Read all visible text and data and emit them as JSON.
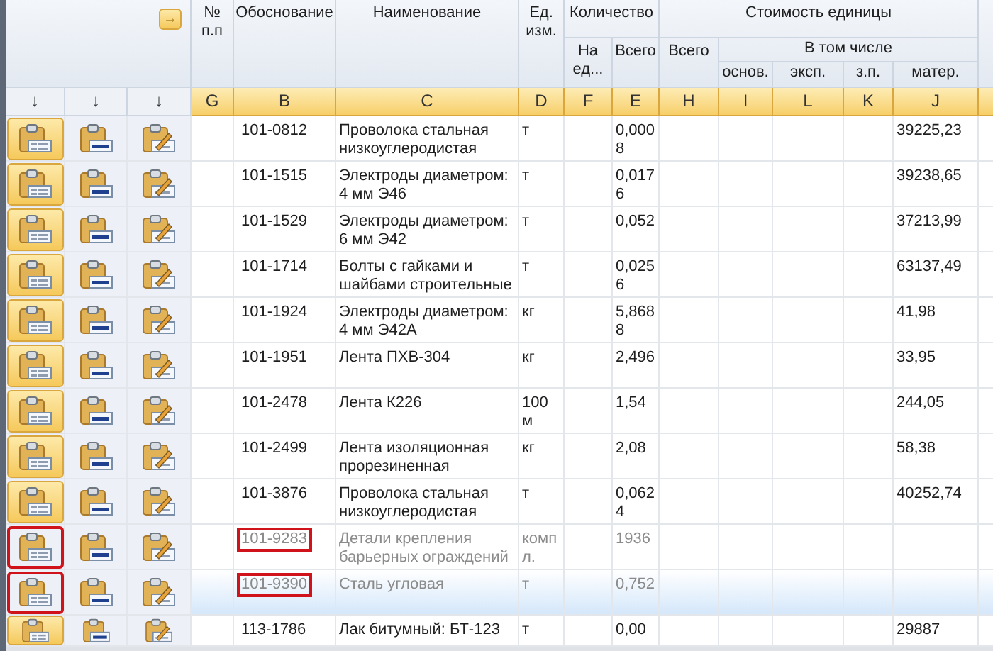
{
  "header": {
    "nav_button": "→",
    "icon_columns": [
      {
        "arrow": "↓"
      },
      {
        "arrow": "↓"
      },
      {
        "arrow": "↓"
      }
    ],
    "columns": [
      {
        "label": "№ п.п",
        "letter": "G"
      },
      {
        "label": "Обоснование",
        "letter": "B"
      },
      {
        "label": "Наименование",
        "letter": "C"
      },
      {
        "label": "Ед. изм.",
        "letter": "D"
      }
    ],
    "quantity": {
      "label": "Количество",
      "columns": [
        {
          "label": "На ед...",
          "letter": "F"
        },
        {
          "label": "Всего",
          "letter": "E"
        }
      ]
    },
    "unit_cost": {
      "label": "Стоимость единицы",
      "total": {
        "label": "Всего",
        "letter": "H"
      },
      "breakdown": {
        "label": "В том числе",
        "columns": [
          {
            "label": "основ.",
            "letter": "I"
          },
          {
            "label": "эксп.",
            "letter": "L"
          },
          {
            "label": "з.п.",
            "letter": "K"
          },
          {
            "label": "матер.",
            "letter": "J"
          }
        ]
      }
    }
  },
  "rows": [
    {
      "code": "101-0812",
      "name": "Проволока стальная низкоуглеродистая",
      "unit": "т",
      "total": "0,0008",
      "material": "39225,23",
      "pressed": true,
      "greyed": false,
      "selected": false,
      "marked": false
    },
    {
      "code": "101-1515",
      "name": "Электроды диаметром: 4 мм Э46",
      "unit": "т",
      "total": "0,0176",
      "material": "39238,65",
      "pressed": true,
      "greyed": false,
      "selected": false,
      "marked": false
    },
    {
      "code": "101-1529",
      "name": "Электроды диаметром: 6 мм Э42",
      "unit": "т",
      "total": "0,052",
      "material": "37213,99",
      "pressed": true,
      "greyed": false,
      "selected": false,
      "marked": false
    },
    {
      "code": "101-1714",
      "name": "Болты с гайками и шайбами строительные",
      "unit": "т",
      "total": "0,0256",
      "material": "63137,49",
      "pressed": true,
      "greyed": false,
      "selected": false,
      "marked": false
    },
    {
      "code": "101-1924",
      "name": "Электроды диаметром: 4 мм Э42А",
      "unit": "кг",
      "total": "5,8688",
      "material": "41,98",
      "pressed": true,
      "greyed": false,
      "selected": false,
      "marked": false
    },
    {
      "code": "101-1951",
      "name": "Лента ПХВ-304",
      "unit": "кг",
      "total": "2,496",
      "material": "33,95",
      "pressed": true,
      "greyed": false,
      "selected": false,
      "marked": false
    },
    {
      "code": "101-2478",
      "name": "Лента К226",
      "unit": "100 м",
      "total": "1,54",
      "material": "244,05",
      "pressed": true,
      "greyed": false,
      "selected": false,
      "marked": false
    },
    {
      "code": "101-2499",
      "name": "Лента изоляционная прорезиненная",
      "unit": "кг",
      "total": "2,08",
      "material": "58,38",
      "pressed": true,
      "greyed": false,
      "selected": false,
      "marked": false
    },
    {
      "code": "101-3876",
      "name": "Проволока стальная низкоуглеродистая",
      "unit": "т",
      "total": "0,0624",
      "material": "40252,74",
      "pressed": true,
      "greyed": false,
      "selected": false,
      "marked": false
    },
    {
      "code": "101-9283",
      "name": "Детали крепления барьерных ограждений",
      "unit": "компл.",
      "total": "1936",
      "pressed": false,
      "greyed": true,
      "selected": false,
      "marked": true
    },
    {
      "code": "101-9390",
      "name": "Сталь угловая",
      "unit": "т",
      "total": "0,752",
      "pressed": false,
      "greyed": true,
      "selected": true,
      "marked": true
    },
    {
      "code": "113-1786",
      "name": "Лак битумный: БТ-123",
      "unit": "т",
      "total": "0,00",
      "material": "29887",
      "pressed": true,
      "greyed": false,
      "selected": false,
      "marked": false
    }
  ]
}
